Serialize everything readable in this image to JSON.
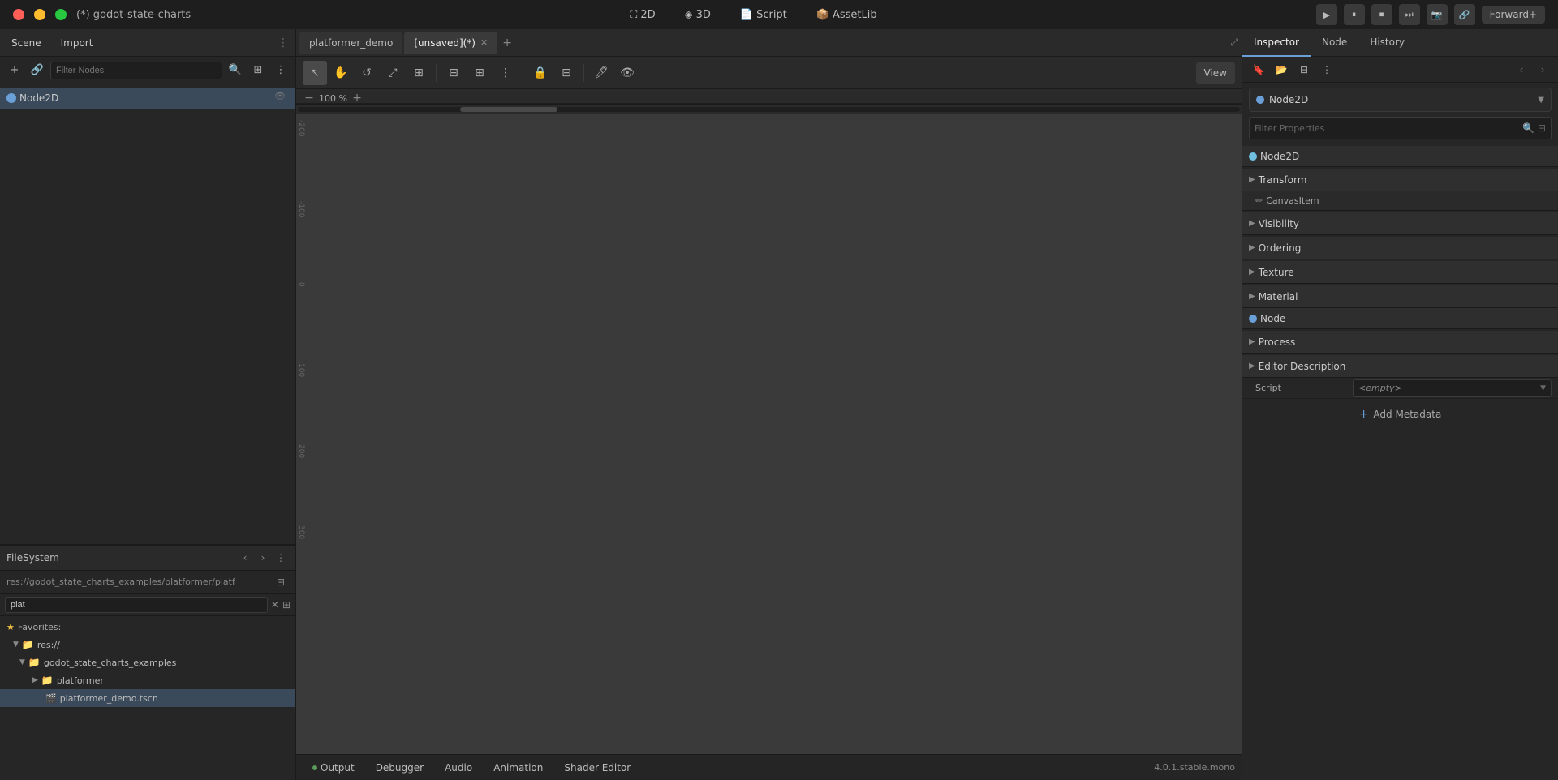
{
  "title_bar": {
    "title": "(*) godot-state-charts",
    "modes": [
      "2D",
      "3D",
      "Script",
      "AssetLib"
    ],
    "play_buttons": [
      "▶",
      "⏸",
      "⏹",
      "⏮",
      "⏭"
    ],
    "forward_label": "Forward+"
  },
  "scene_panel": {
    "tabs": [
      "Scene",
      "Import"
    ],
    "filter_placeholder": "Filter Nodes",
    "nodes": [
      {
        "label": "Node2D",
        "selected": true
      }
    ]
  },
  "filesystem_panel": {
    "title": "FileSystem",
    "path": "res://godot_state_charts_examples/platformer/platf",
    "filter_value": "plat",
    "favorites_label": "Favorites:",
    "items": [
      {
        "label": "res://",
        "indent": 0,
        "type": "folder",
        "expanded": true
      },
      {
        "label": "godot_state_charts_examples",
        "indent": 1,
        "type": "folder",
        "expanded": true
      },
      {
        "label": "platformer",
        "indent": 2,
        "type": "folder",
        "expanded": true
      },
      {
        "label": "platformer_demo.tscn",
        "indent": 3,
        "type": "file",
        "selected": true
      }
    ]
  },
  "editor_tabs": {
    "tabs": [
      {
        "label": "platformer_demo",
        "active": false,
        "closeable": false
      },
      {
        "label": "[unsaved](*)",
        "active": true,
        "closeable": true
      }
    ]
  },
  "editor_toolbar": {
    "tools": [
      "↖",
      "✋",
      "↔",
      "⤡",
      "⋮⋮",
      "⊞",
      "⋯",
      "🔒",
      "⊟",
      "🖊",
      "👁"
    ],
    "view_label": "View",
    "zoom_level": "100 %"
  },
  "canvas": {
    "zoom": "100 %"
  },
  "inspector": {
    "tabs": [
      "Inspector",
      "Node",
      "History"
    ],
    "node_name": "Node2D",
    "filter_placeholder": "Filter Properties",
    "sections": {
      "node2d_header": "Node2D",
      "transform": {
        "label": "Transform",
        "sub_header": "CanvasItem"
      },
      "visibility": {
        "label": "Visibility"
      },
      "ordering": {
        "label": "Ordering"
      },
      "texture": {
        "label": "Texture"
      },
      "material": {
        "label": "Material"
      },
      "node_section": {
        "label": "Node"
      },
      "process": {
        "label": "Process"
      },
      "editor_description": {
        "label": "Editor Description"
      },
      "script": {
        "label": "Script",
        "value": "<empty>"
      }
    },
    "add_metadata_label": "Add Metadata"
  },
  "bottom_tabs": {
    "tabs": [
      "Output",
      "Debugger",
      "Audio",
      "Animation",
      "Shader Editor"
    ],
    "version": "4.0.1.stable.mono"
  }
}
